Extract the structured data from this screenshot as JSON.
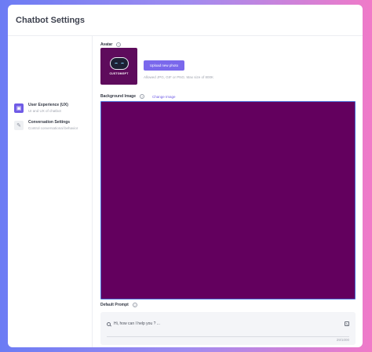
{
  "header": {
    "title": "Chatbot Settings"
  },
  "sidebar": {
    "items": [
      {
        "label": "User Experience (UX)",
        "description": "UI and UX of chatbot",
        "icon": "palette-icon",
        "active": true
      },
      {
        "label": "Conversation Settings",
        "description": "Control conversational behavior",
        "icon": "chat-settings-icon",
        "active": false
      }
    ]
  },
  "avatar": {
    "label": "Avatar",
    "bot_name": "CUSTOMGPT",
    "upload_label": "Upload new photo",
    "hint": "Allowed JPG, GIF or PNG. Max size of 800K"
  },
  "background": {
    "label": "Background Image",
    "change_label": "Change Image",
    "color": "#63005e"
  },
  "prompt": {
    "label": "Default Prompt",
    "placeholder": "Hi, how can I help you ? ...",
    "counter": "29/1000"
  },
  "colors": {
    "accent": "#7a68ec",
    "background_image": "#63005e",
    "focus_border": "#4b6fd8"
  }
}
